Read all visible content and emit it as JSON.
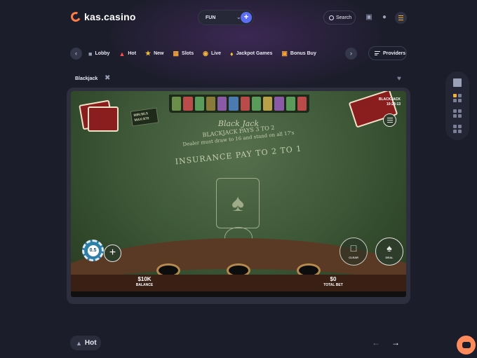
{
  "brand": {
    "name": "kas.casino"
  },
  "header": {
    "mode_value": "FUN",
    "search_label": "Search"
  },
  "categories": [
    {
      "label": "Lobby",
      "icon": "lobby-icon"
    },
    {
      "label": "Hot",
      "icon": "flame-icon"
    },
    {
      "label": "New",
      "icon": "star-icon"
    },
    {
      "label": "Slots",
      "icon": "slots-icon"
    },
    {
      "label": "Live",
      "icon": "live-icon"
    },
    {
      "label": "Jackpot Games",
      "icon": "jackpot-icon"
    },
    {
      "label": "Bonus Buy",
      "icon": "bonus-buy-icon"
    }
  ],
  "providers_label": "Providers",
  "game": {
    "title": "Blackjack",
    "table": {
      "name": "Black Jack",
      "pays_line": "BLACKJACK PAYS 3 TO 2",
      "rule_line": "Dealer must draw to 16 and stand on all 17's",
      "insurance_line": "INSURANCE PAY TO 2 TO 1",
      "min_bet": "MIN:$0.5",
      "max_bet": "MAX:$70",
      "game_name_small": "BLACKJACK",
      "time": "10:23:13",
      "chip_value": "0.5",
      "clear_label": "CLEAR",
      "deal_label": "DEAL",
      "balance_value": "$10K",
      "balance_label": "BALANCE",
      "total_bet_value": "$0",
      "total_bet_label": "TOTAL BET"
    }
  },
  "footer": {
    "section_label": "Hot"
  },
  "colors": {
    "accent": "#5b6ef5",
    "brand": "#ff7a45",
    "chat": "#ff8a5c",
    "background": "#1c1d2b"
  }
}
